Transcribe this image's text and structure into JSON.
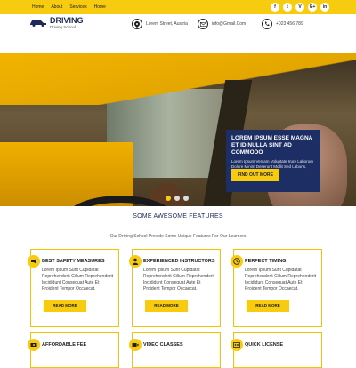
{
  "topbar": {
    "nav": [
      "Home",
      "About",
      "Services",
      "Home"
    ],
    "social": [
      "f",
      "t",
      "V",
      "G+",
      "in"
    ]
  },
  "header": {
    "brand": "DRIVING",
    "tagline": "Driving School",
    "address": "Lorem Street, Austria",
    "email": "info@Gmail.Com",
    "phone": "+023 456 789"
  },
  "hero": {
    "heading": "LOREM IPSUM ESSE MAGNA ET ID NULLA SINT AD COMMODO",
    "text": "Lorem Ipsum Veniam Voluptate Irure Laborum Dolore Minim Deserunt Mollit Sed Laboris.",
    "button": "FIND OUT MORE",
    "slides": 3,
    "active_slide": 1
  },
  "features": {
    "title": "SOME AWESOME FEATURES",
    "subtitle": "Our Driving School Provide Some Unique Features For Our Learners",
    "cards": [
      {
        "title": "BEST SAFETY MEASURES",
        "text": "Lorem Ipsum Sunt Cupidatat Reprehenderit Cillum Reprehenderit Incididunt Consequat Aute Et Proident Tempor Occaecat.",
        "button": "READ MORE",
        "icon": "megaphone-icon"
      },
      {
        "title": "EXPERIENCED INSTRUCTORS",
        "text": "Lorem Ipsum Sunt Cupidatat Reprehenderit Cillum Reprehenderit Incididunt Consequat Aute Et Proident Tempor Occaecat.",
        "button": "READ MORE",
        "icon": "user-icon"
      },
      {
        "title": "PERFECT TIMING",
        "text": "Lorem Ipsum Sunt Cupidatat Reprehenderit Cillum Reprehenderit Incididunt Consequat Aute Et Proident Tempor Occaecat.",
        "button": "READ MORE",
        "icon": "clock-icon"
      },
      {
        "title": "AFFORDABLE FEE",
        "icon": "money-icon"
      },
      {
        "title": "VIDEO CLASSES",
        "icon": "video-icon"
      },
      {
        "title": "QUICK LICENSE",
        "icon": "license-icon"
      }
    ]
  },
  "colors": {
    "accent": "#f7cb10",
    "navy": "#1c2e63"
  }
}
